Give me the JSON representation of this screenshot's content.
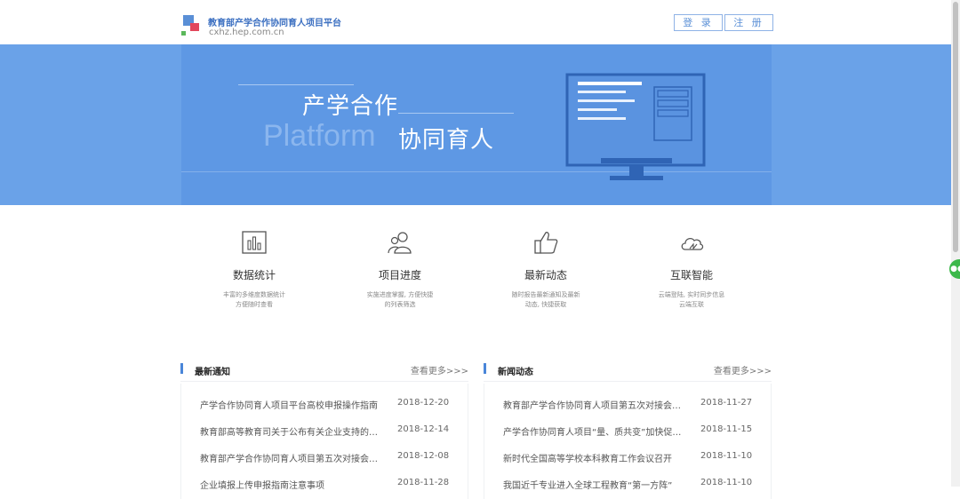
{
  "header": {
    "site_title": "教育部产学合作协同育人项目平台",
    "site_url": "cxhz.hep.com.cn",
    "login_label": "登 录",
    "register_label": "注 册"
  },
  "banner": {
    "line1": "产学合作",
    "platform_text": "Platform",
    "line2": "协同育人"
  },
  "features": [
    {
      "title": "数据统计",
      "desc": "丰富的多维度数据统计\n方便随时查看",
      "icon": "bar-chart-icon"
    },
    {
      "title": "项目进度",
      "desc": "实施进度掌握, 方便快捷\n的列表筛选",
      "icon": "users-icon"
    },
    {
      "title": "最新动态",
      "desc": "随时报告最新通知及最新\n动态, 快捷获取",
      "icon": "thumbs-up-icon"
    },
    {
      "title": "互联智能",
      "desc": "云端登陆, 实时同步信息\n云端互联",
      "icon": "cloud-icon"
    }
  ],
  "notices": {
    "title": "最新通知",
    "more": "查看更多>>>",
    "items": [
      {
        "title": "产学合作协同育人项目平台高校申报操作指南",
        "date": "2018-12-20"
      },
      {
        "title": "教育部高等教育司关于公布有关企业支持的产学合作协同育人项目",
        "date": "2018-12-14"
      },
      {
        "title": "教育部产学合作协同育人项目第五次对接会会议",
        "date": "2018-12-08"
      },
      {
        "title": "企业填报上传申报指南注意事项",
        "date": "2018-11-28"
      }
    ]
  },
  "news": {
    "title": "新闻动态",
    "more": "查看更多>>>",
    "items": [
      {
        "title": "教育部产学合作协同育人项目第五次对接会召开",
        "date": "2018-11-27"
      },
      {
        "title": "产学合作协同育人项目“量、质共变”加快促进校企合作",
        "date": "2018-11-15"
      },
      {
        "title": "新时代全国高等学校本科教育工作会议召开",
        "date": "2018-11-10"
      },
      {
        "title": "我国近千专业进入全球工程教育“第一方阵”",
        "date": "2018-11-10"
      }
    ]
  },
  "colors": {
    "brand": "#5a8fd6",
    "banner": "#6aa2e8"
  }
}
